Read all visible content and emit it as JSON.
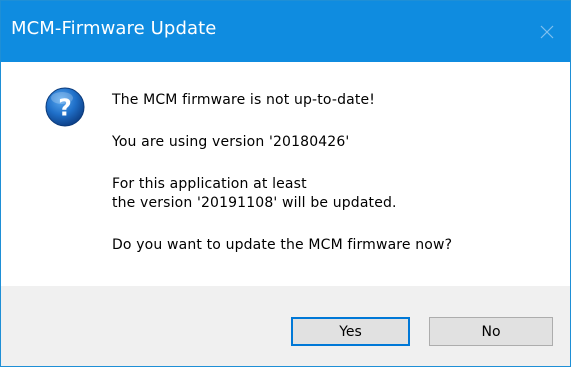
{
  "window": {
    "title": "MCM-Firmware Update"
  },
  "dialog": {
    "icon": "question-icon",
    "lines": [
      "The MCM firmware is not up-to-date!",
      "You are using version '20180426'",
      "For this application at least",
      "the version '20191108' will be updated.",
      "Do you want to update the MCM firmware now?"
    ]
  },
  "buttons": {
    "yes_label": "Yes",
    "no_label": "No"
  },
  "colors": {
    "titlebar": "#0f8ce0",
    "icon_blue": "#1a6fc4",
    "focus_border": "#0078d7",
    "footer": "#f0f0f0"
  }
}
